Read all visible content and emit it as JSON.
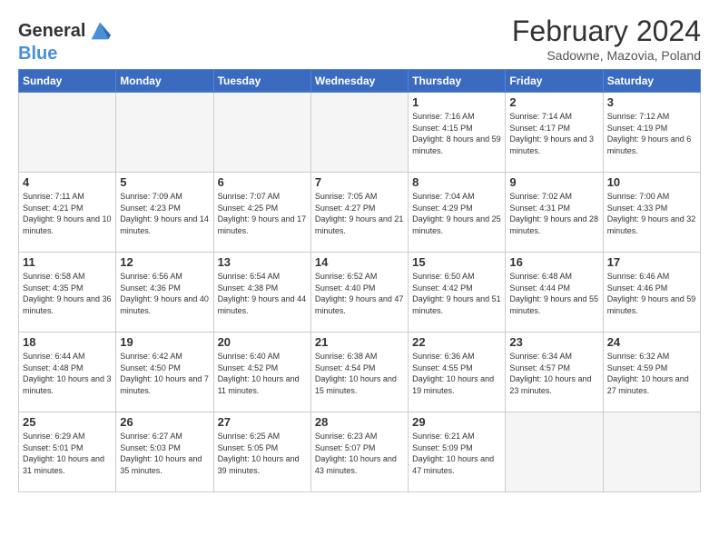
{
  "logo": {
    "line1": "General",
    "line2": "Blue"
  },
  "title": "February 2024",
  "subtitle": "Sadowne, Mazovia, Poland",
  "days_header": [
    "Sunday",
    "Monday",
    "Tuesday",
    "Wednesday",
    "Thursday",
    "Friday",
    "Saturday"
  ],
  "weeks": [
    [
      {
        "day": "",
        "empty": true
      },
      {
        "day": "",
        "empty": true
      },
      {
        "day": "",
        "empty": true
      },
      {
        "day": "",
        "empty": true
      },
      {
        "day": "1",
        "sunrise": "7:16 AM",
        "sunset": "4:15 PM",
        "daylight": "8 hours and 59 minutes."
      },
      {
        "day": "2",
        "sunrise": "7:14 AM",
        "sunset": "4:17 PM",
        "daylight": "9 hours and 3 minutes."
      },
      {
        "day": "3",
        "sunrise": "7:12 AM",
        "sunset": "4:19 PM",
        "daylight": "9 hours and 6 minutes."
      }
    ],
    [
      {
        "day": "4",
        "sunrise": "7:11 AM",
        "sunset": "4:21 PM",
        "daylight": "9 hours and 10 minutes."
      },
      {
        "day": "5",
        "sunrise": "7:09 AM",
        "sunset": "4:23 PM",
        "daylight": "9 hours and 14 minutes."
      },
      {
        "day": "6",
        "sunrise": "7:07 AM",
        "sunset": "4:25 PM",
        "daylight": "9 hours and 17 minutes."
      },
      {
        "day": "7",
        "sunrise": "7:05 AM",
        "sunset": "4:27 PM",
        "daylight": "9 hours and 21 minutes."
      },
      {
        "day": "8",
        "sunrise": "7:04 AM",
        "sunset": "4:29 PM",
        "daylight": "9 hours and 25 minutes."
      },
      {
        "day": "9",
        "sunrise": "7:02 AM",
        "sunset": "4:31 PM",
        "daylight": "9 hours and 28 minutes."
      },
      {
        "day": "10",
        "sunrise": "7:00 AM",
        "sunset": "4:33 PM",
        "daylight": "9 hours and 32 minutes."
      }
    ],
    [
      {
        "day": "11",
        "sunrise": "6:58 AM",
        "sunset": "4:35 PM",
        "daylight": "9 hours and 36 minutes."
      },
      {
        "day": "12",
        "sunrise": "6:56 AM",
        "sunset": "4:36 PM",
        "daylight": "9 hours and 40 minutes."
      },
      {
        "day": "13",
        "sunrise": "6:54 AM",
        "sunset": "4:38 PM",
        "daylight": "9 hours and 44 minutes."
      },
      {
        "day": "14",
        "sunrise": "6:52 AM",
        "sunset": "4:40 PM",
        "daylight": "9 hours and 47 minutes."
      },
      {
        "day": "15",
        "sunrise": "6:50 AM",
        "sunset": "4:42 PM",
        "daylight": "9 hours and 51 minutes."
      },
      {
        "day": "16",
        "sunrise": "6:48 AM",
        "sunset": "4:44 PM",
        "daylight": "9 hours and 55 minutes."
      },
      {
        "day": "17",
        "sunrise": "6:46 AM",
        "sunset": "4:46 PM",
        "daylight": "9 hours and 59 minutes."
      }
    ],
    [
      {
        "day": "18",
        "sunrise": "6:44 AM",
        "sunset": "4:48 PM",
        "daylight": "10 hours and 3 minutes."
      },
      {
        "day": "19",
        "sunrise": "6:42 AM",
        "sunset": "4:50 PM",
        "daylight": "10 hours and 7 minutes."
      },
      {
        "day": "20",
        "sunrise": "6:40 AM",
        "sunset": "4:52 PM",
        "daylight": "10 hours and 11 minutes."
      },
      {
        "day": "21",
        "sunrise": "6:38 AM",
        "sunset": "4:54 PM",
        "daylight": "10 hours and 15 minutes."
      },
      {
        "day": "22",
        "sunrise": "6:36 AM",
        "sunset": "4:55 PM",
        "daylight": "10 hours and 19 minutes."
      },
      {
        "day": "23",
        "sunrise": "6:34 AM",
        "sunset": "4:57 PM",
        "daylight": "10 hours and 23 minutes."
      },
      {
        "day": "24",
        "sunrise": "6:32 AM",
        "sunset": "4:59 PM",
        "daylight": "10 hours and 27 minutes."
      }
    ],
    [
      {
        "day": "25",
        "sunrise": "6:29 AM",
        "sunset": "5:01 PM",
        "daylight": "10 hours and 31 minutes."
      },
      {
        "day": "26",
        "sunrise": "6:27 AM",
        "sunset": "5:03 PM",
        "daylight": "10 hours and 35 minutes."
      },
      {
        "day": "27",
        "sunrise": "6:25 AM",
        "sunset": "5:05 PM",
        "daylight": "10 hours and 39 minutes."
      },
      {
        "day": "28",
        "sunrise": "6:23 AM",
        "sunset": "5:07 PM",
        "daylight": "10 hours and 43 minutes."
      },
      {
        "day": "29",
        "sunrise": "6:21 AM",
        "sunset": "5:09 PM",
        "daylight": "10 hours and 47 minutes."
      },
      {
        "day": "",
        "empty": true
      },
      {
        "day": "",
        "empty": true
      }
    ]
  ]
}
